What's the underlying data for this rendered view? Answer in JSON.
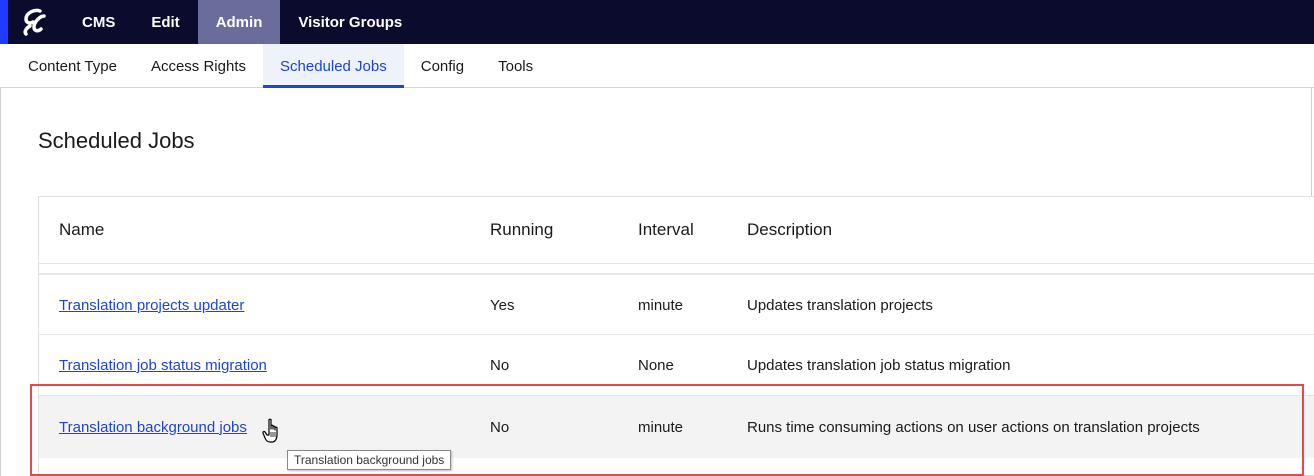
{
  "topnav": {
    "items": [
      {
        "label": "CMS",
        "active": false
      },
      {
        "label": "Edit",
        "active": false
      },
      {
        "label": "Admin",
        "active": true
      },
      {
        "label": "Visitor Groups",
        "active": false
      }
    ]
  },
  "subnav": {
    "items": [
      {
        "label": "Content Type",
        "active": false
      },
      {
        "label": "Access Rights",
        "active": false
      },
      {
        "label": "Scheduled Jobs",
        "active": true
      },
      {
        "label": "Config",
        "active": false
      },
      {
        "label": "Tools",
        "active": false
      }
    ]
  },
  "page": {
    "title": "Scheduled Jobs"
  },
  "table": {
    "headers": {
      "name": "Name",
      "running": "Running",
      "interval": "Interval",
      "description": "Description"
    },
    "rows": [
      {
        "name": "Translation projects updater",
        "running": "Yes",
        "interval": "minute",
        "description": "Updates translation projects"
      },
      {
        "name": "Translation job status migration",
        "running": "No",
        "interval": "None",
        "description": "Updates translation job status migration"
      },
      {
        "name": "Translation background jobs",
        "running": "No",
        "interval": "minute",
        "description": "Runs time consuming actions on user actions on translation projects"
      }
    ]
  },
  "tooltip": {
    "text": "Translation background jobs"
  },
  "colors": {
    "topbar": "#0b0b2e",
    "active_top": "#6a6c9c",
    "link": "#1f46c8",
    "highlight": "#e84848"
  }
}
